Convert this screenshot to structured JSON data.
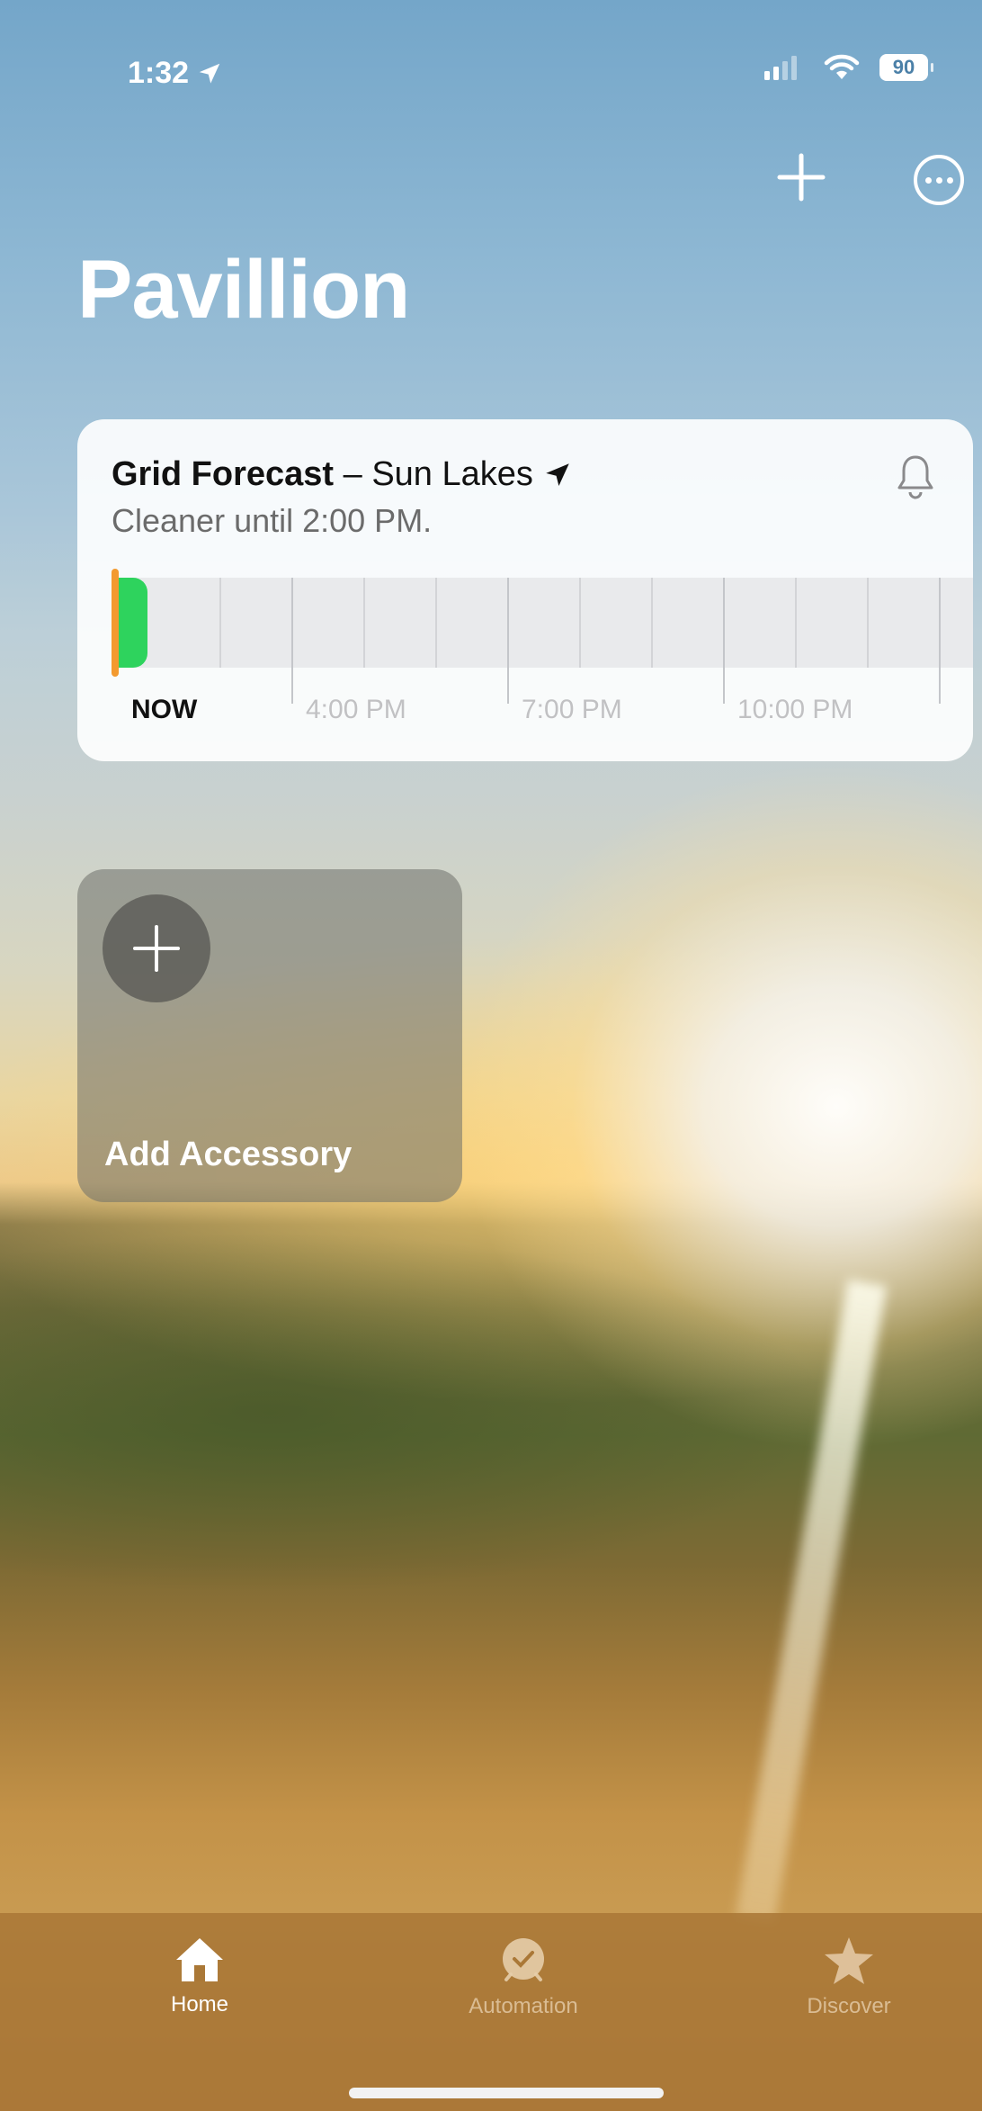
{
  "status_bar": {
    "time": "1:32",
    "battery": "90"
  },
  "toolbar": {
    "add_icon": "plus-icon",
    "more_icon": "ellipsis-circle-icon"
  },
  "home": {
    "title": "Pavillion"
  },
  "grid_forecast": {
    "title_bold": "Grid Forecast",
    "title_rest": " – Sun Lakes",
    "subtitle": "Cleaner until 2:00 PM.",
    "now_label": "NOW",
    "time_labels": [
      "4:00 PM",
      "7:00 PM",
      "10:00 PM"
    ],
    "colors": {
      "now_marker": "#f39a2f",
      "clean": "#2ed35d"
    }
  },
  "accessory": {
    "label": "Add Accessory"
  },
  "tabs": [
    {
      "label": "Home",
      "icon": "house-icon",
      "selected": true
    },
    {
      "label": "Automation",
      "icon": "clock-icon",
      "selected": false
    },
    {
      "label": "Discover",
      "icon": "star-icon",
      "selected": false
    }
  ]
}
